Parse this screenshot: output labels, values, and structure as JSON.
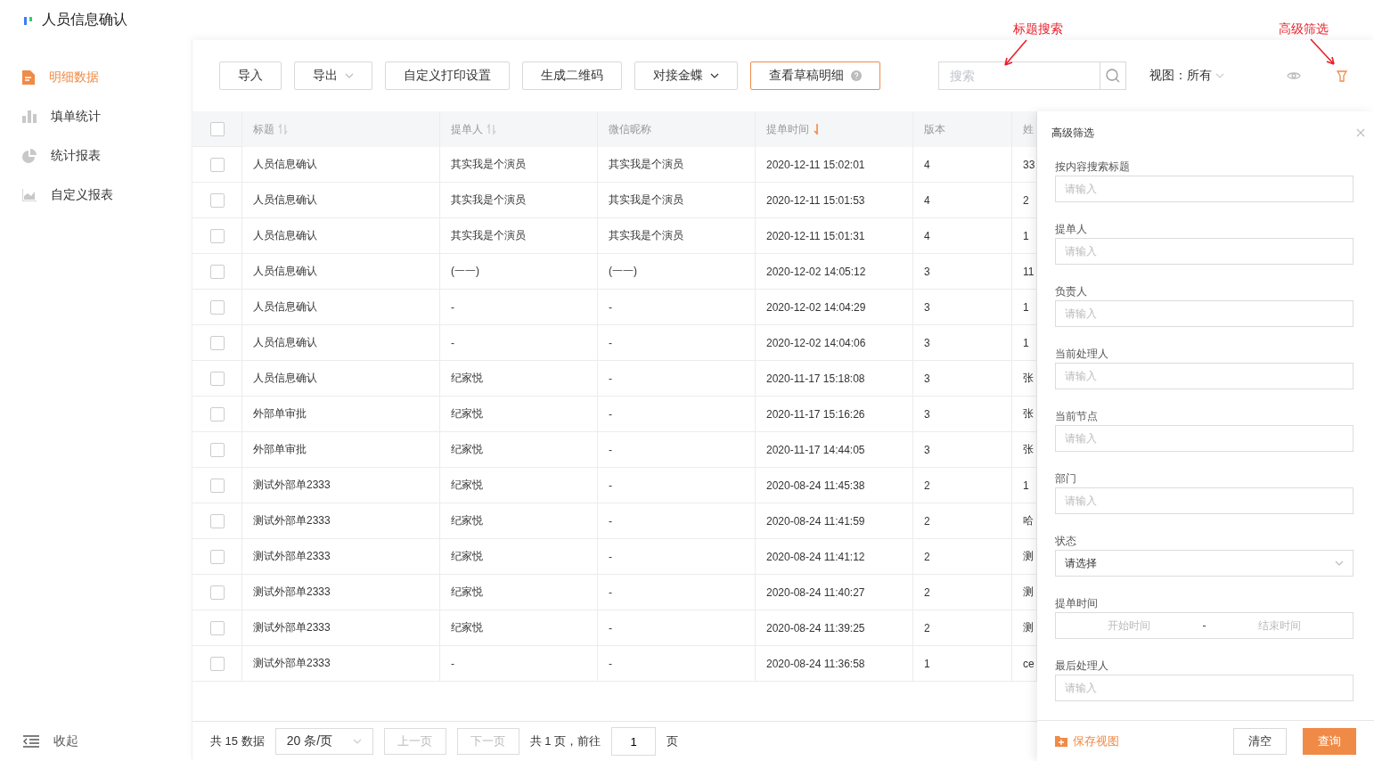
{
  "app": {
    "title": "人员信息确认"
  },
  "sidebar": {
    "items": [
      {
        "label": "明细数据",
        "selected": true
      },
      {
        "label": "填单统计",
        "selected": false
      },
      {
        "label": "统计报表",
        "selected": false
      },
      {
        "label": "自定义报表",
        "selected": false
      }
    ],
    "collapse": "收起"
  },
  "toolbar": {
    "buttons": [
      {
        "label": "导入",
        "kind": "plain"
      },
      {
        "label": "导出",
        "kind": "dropdown"
      },
      {
        "label": "自定义打印设置",
        "kind": "plain"
      },
      {
        "label": "生成二维码",
        "kind": "plain"
      },
      {
        "label": "对接金蝶",
        "kind": "menu"
      },
      {
        "label": "查看草稿明细",
        "kind": "help"
      }
    ],
    "search": {
      "placeholder": "搜索",
      "annotation": "标题搜索"
    },
    "view": {
      "label": "视图：",
      "value": "所有"
    },
    "filter": {
      "annotation": "高级筛选",
      "active": true
    }
  },
  "table": {
    "all_checked": false,
    "columns": [
      {
        "label": "标题",
        "sortable": true,
        "sorted": false
      },
      {
        "label": "提单人",
        "sortable": true,
        "sorted": false
      },
      {
        "label": "微信昵称",
        "sortable": false,
        "sorted": false
      },
      {
        "label": "提单时间",
        "sortable": true,
        "sorted": true
      },
      {
        "label": "版本",
        "sortable": false,
        "sorted": false
      },
      {
        "label": "姓"
      }
    ],
    "rows": [
      {
        "checked": false,
        "cells": [
          "人员信息确认",
          "其实我是个演员",
          "其实我是个演员",
          "2020-12-11 15:02:01",
          "4",
          "33"
        ]
      },
      {
        "checked": false,
        "cells": [
          "人员信息确认",
          "其实我是个演员",
          "其实我是个演员",
          "2020-12-11 15:01:53",
          "4",
          "2"
        ]
      },
      {
        "checked": false,
        "cells": [
          "人员信息确认",
          "其实我是个演员",
          "其实我是个演员",
          "2020-12-11 15:01:31",
          "4",
          "1"
        ]
      },
      {
        "checked": false,
        "cells": [
          "人员信息确认",
          "(一一)",
          "(一一)",
          "2020-12-02 14:05:12",
          "3",
          "11"
        ]
      },
      {
        "checked": false,
        "cells": [
          "人员信息确认",
          "-",
          "-",
          "2020-12-02 14:04:29",
          "3",
          "1"
        ]
      },
      {
        "checked": false,
        "cells": [
          "人员信息确认",
          "-",
          "-",
          "2020-12-02 14:04:06",
          "3",
          "1"
        ]
      },
      {
        "checked": false,
        "cells": [
          "人员信息确认",
          "纪家悦",
          "-",
          "2020-11-17 15:18:08",
          "3",
          "张"
        ]
      },
      {
        "checked": false,
        "cells": [
          "外部单审批",
          "纪家悦",
          "-",
          "2020-11-17 15:16:26",
          "3",
          "张"
        ]
      },
      {
        "checked": false,
        "cells": [
          "外部单审批",
          "纪家悦",
          "-",
          "2020-11-17 14:44:05",
          "3",
          "张"
        ]
      },
      {
        "checked": false,
        "cells": [
          "测试外部单2333",
          "纪家悦",
          "-",
          "2020-08-24 11:45:38",
          "2",
          "1"
        ]
      },
      {
        "checked": false,
        "cells": [
          "测试外部单2333",
          "纪家悦",
          "-",
          "2020-08-24 11:41:59",
          "2",
          "哈"
        ]
      },
      {
        "checked": false,
        "cells": [
          "测试外部单2333",
          "纪家悦",
          "-",
          "2020-08-24 11:41:12",
          "2",
          "测"
        ]
      },
      {
        "checked": false,
        "cells": [
          "测试外部单2333",
          "纪家悦",
          "-",
          "2020-08-24 11:40:27",
          "2",
          "测"
        ]
      },
      {
        "checked": false,
        "cells": [
          "测试外部单2333",
          "纪家悦",
          "-",
          "2020-08-24 11:39:25",
          "2",
          "测"
        ]
      },
      {
        "checked": false,
        "cells": [
          "测试外部单2333",
          "-",
          "-",
          "2020-08-24 11:36:58",
          "1",
          "ce"
        ]
      }
    ]
  },
  "pagination": {
    "total": "共 15 数据",
    "page_size": "20 条/页",
    "prev": "上一页",
    "next": "下一页",
    "pages": "共 1 页，前往",
    "page": "1",
    "suffix": "页"
  },
  "filter_panel": {
    "title": "高级筛选",
    "fields": [
      {
        "label": "按内容搜索标题",
        "kind": "input",
        "placeholder": "请输入"
      },
      {
        "label": "提单人",
        "kind": "input",
        "placeholder": "请输入"
      },
      {
        "label": "负责人",
        "kind": "input",
        "placeholder": "请输入"
      },
      {
        "label": "当前处理人",
        "kind": "input",
        "placeholder": "请输入"
      },
      {
        "label": "当前节点",
        "kind": "input",
        "placeholder": "请输入"
      },
      {
        "label": "部门",
        "kind": "input",
        "placeholder": "请输入"
      },
      {
        "label": "状态",
        "kind": "select",
        "value": "请选择"
      },
      {
        "label": "提单时间",
        "kind": "range",
        "start_placeholder": "开始时间",
        "separator": "-",
        "end_placeholder": "结束时间"
      },
      {
        "label": "最后处理人",
        "kind": "input",
        "placeholder": "请输入"
      }
    ],
    "save_view": "保存视图",
    "buttons": [
      {
        "label": "清空",
        "kind": "default"
      },
      {
        "label": "查询",
        "kind": "primary"
      }
    ]
  }
}
